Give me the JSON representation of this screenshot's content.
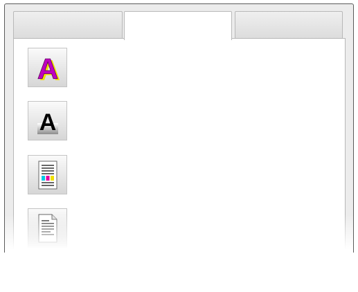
{
  "tabs": [
    {
      "label": "",
      "active": false
    },
    {
      "label": "",
      "active": true
    },
    {
      "label": "",
      "active": false
    }
  ],
  "icons": [
    {
      "name": "color-text-icon",
      "colors": {
        "fill": "#c000c0",
        "shadow": "#f0e000"
      }
    },
    {
      "name": "grayscale-text-icon",
      "colors": {
        "fill": "#000000",
        "shadow": "#8c8c8c"
      }
    },
    {
      "name": "color-document-icon",
      "colors": {
        "cyan": "#00c8e6",
        "magenta": "#e600a0",
        "yellow": "#f0e000"
      }
    },
    {
      "name": "plain-document-icon",
      "colors": {
        "lines": "#333333"
      }
    }
  ]
}
